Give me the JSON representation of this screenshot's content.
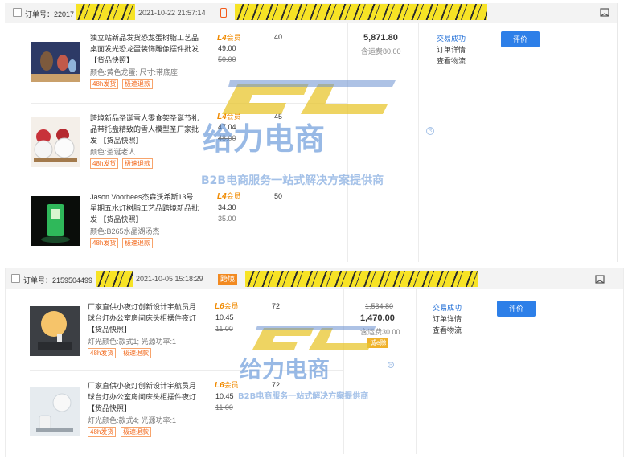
{
  "orders": [
    {
      "order_label": "订单号：22017",
      "time": "2021-10-22 21:57:14",
      "items": [
        {
          "title": "独立站新品发货恐龙蛋树脂工艺品桌面发光恐龙蛋装饰雕像摆件批发 【货品快照】",
          "attr": "颜色:黄色龙蛋;  尺寸:带底座",
          "level": "L4",
          "level_suffix": "会员",
          "price": "49.00",
          "orig_price": "50.00",
          "qty": "40",
          "services": [
            "48h发货",
            "极速退款"
          ]
        },
        {
          "title": "跨境新品圣诞雪人零食架圣诞节礼品带托盘精致的雪人模型圣厂家批发 【货品快照】",
          "attr": "颜色:圣诞老人",
          "level": "L4",
          "level_suffix": "会员",
          "price": "47.04",
          "orig_price": "48.00",
          "qty": "45",
          "services": [
            "48h发货",
            "极速退款"
          ]
        },
        {
          "title": "Jason Voorhees杰森沃希斯13号星期五水灯树脂工艺品跨境新品批发 【货品快照】",
          "attr": "颜色:B265水晶湖汤杰",
          "level": "L4",
          "level_suffix": "会员",
          "price": "34.30",
          "orig_price": "35.00",
          "qty": "50",
          "services": [
            "48h发货",
            "极速退款"
          ]
        }
      ],
      "total": "5,871.80",
      "shipping": "含运费80.00",
      "status": "交易成功",
      "detail_link": "订单详情",
      "logistics_link": "查看物流",
      "button": "评价"
    },
    {
      "order_label": "订单号：2159504499",
      "time": "2021-10-05 15:18:29",
      "tag": "跨境",
      "items": [
        {
          "title": "厂家直供小夜灯创新设计宇航员月球台灯办公室房间床头柜摆件夜灯 【货品快照】",
          "attr": "灯光颜色:款式1;  光源功率:1",
          "level": "L6",
          "level_suffix": "会员",
          "price": "10.45",
          "orig_price": "11.00",
          "qty": "72",
          "services": [
            "48h发货",
            "极速退款"
          ]
        },
        {
          "title": "厂家直供小夜灯创新设计宇航员月球台灯办公室房间床头柜摆件夜灯 【货品快照】",
          "attr": "灯光颜色:款式4;  光源功率:1",
          "level": "L6",
          "level_suffix": "会员",
          "price": "10.45",
          "orig_price": "11.00",
          "qty": "72",
          "services": [
            "48h发货",
            "极速退款"
          ]
        }
      ],
      "orig_total": "1,534.80",
      "total": "1,470.00",
      "shipping": "含运费30.00",
      "stamp": "诚e赊",
      "status": "交易成功",
      "detail_link": "订单详情",
      "logistics_link": "查看物流",
      "button": "评价"
    }
  ],
  "watermark": {
    "logo": "GL",
    "brand": "给力电商",
    "reg": "R",
    "slogan": "B2B电商服务一站式解决方案提供商"
  },
  "colors": {
    "accent": "#2d7fe8",
    "status": "#1b6bd6",
    "level": "#f08a00",
    "service": "#f26a1d"
  }
}
